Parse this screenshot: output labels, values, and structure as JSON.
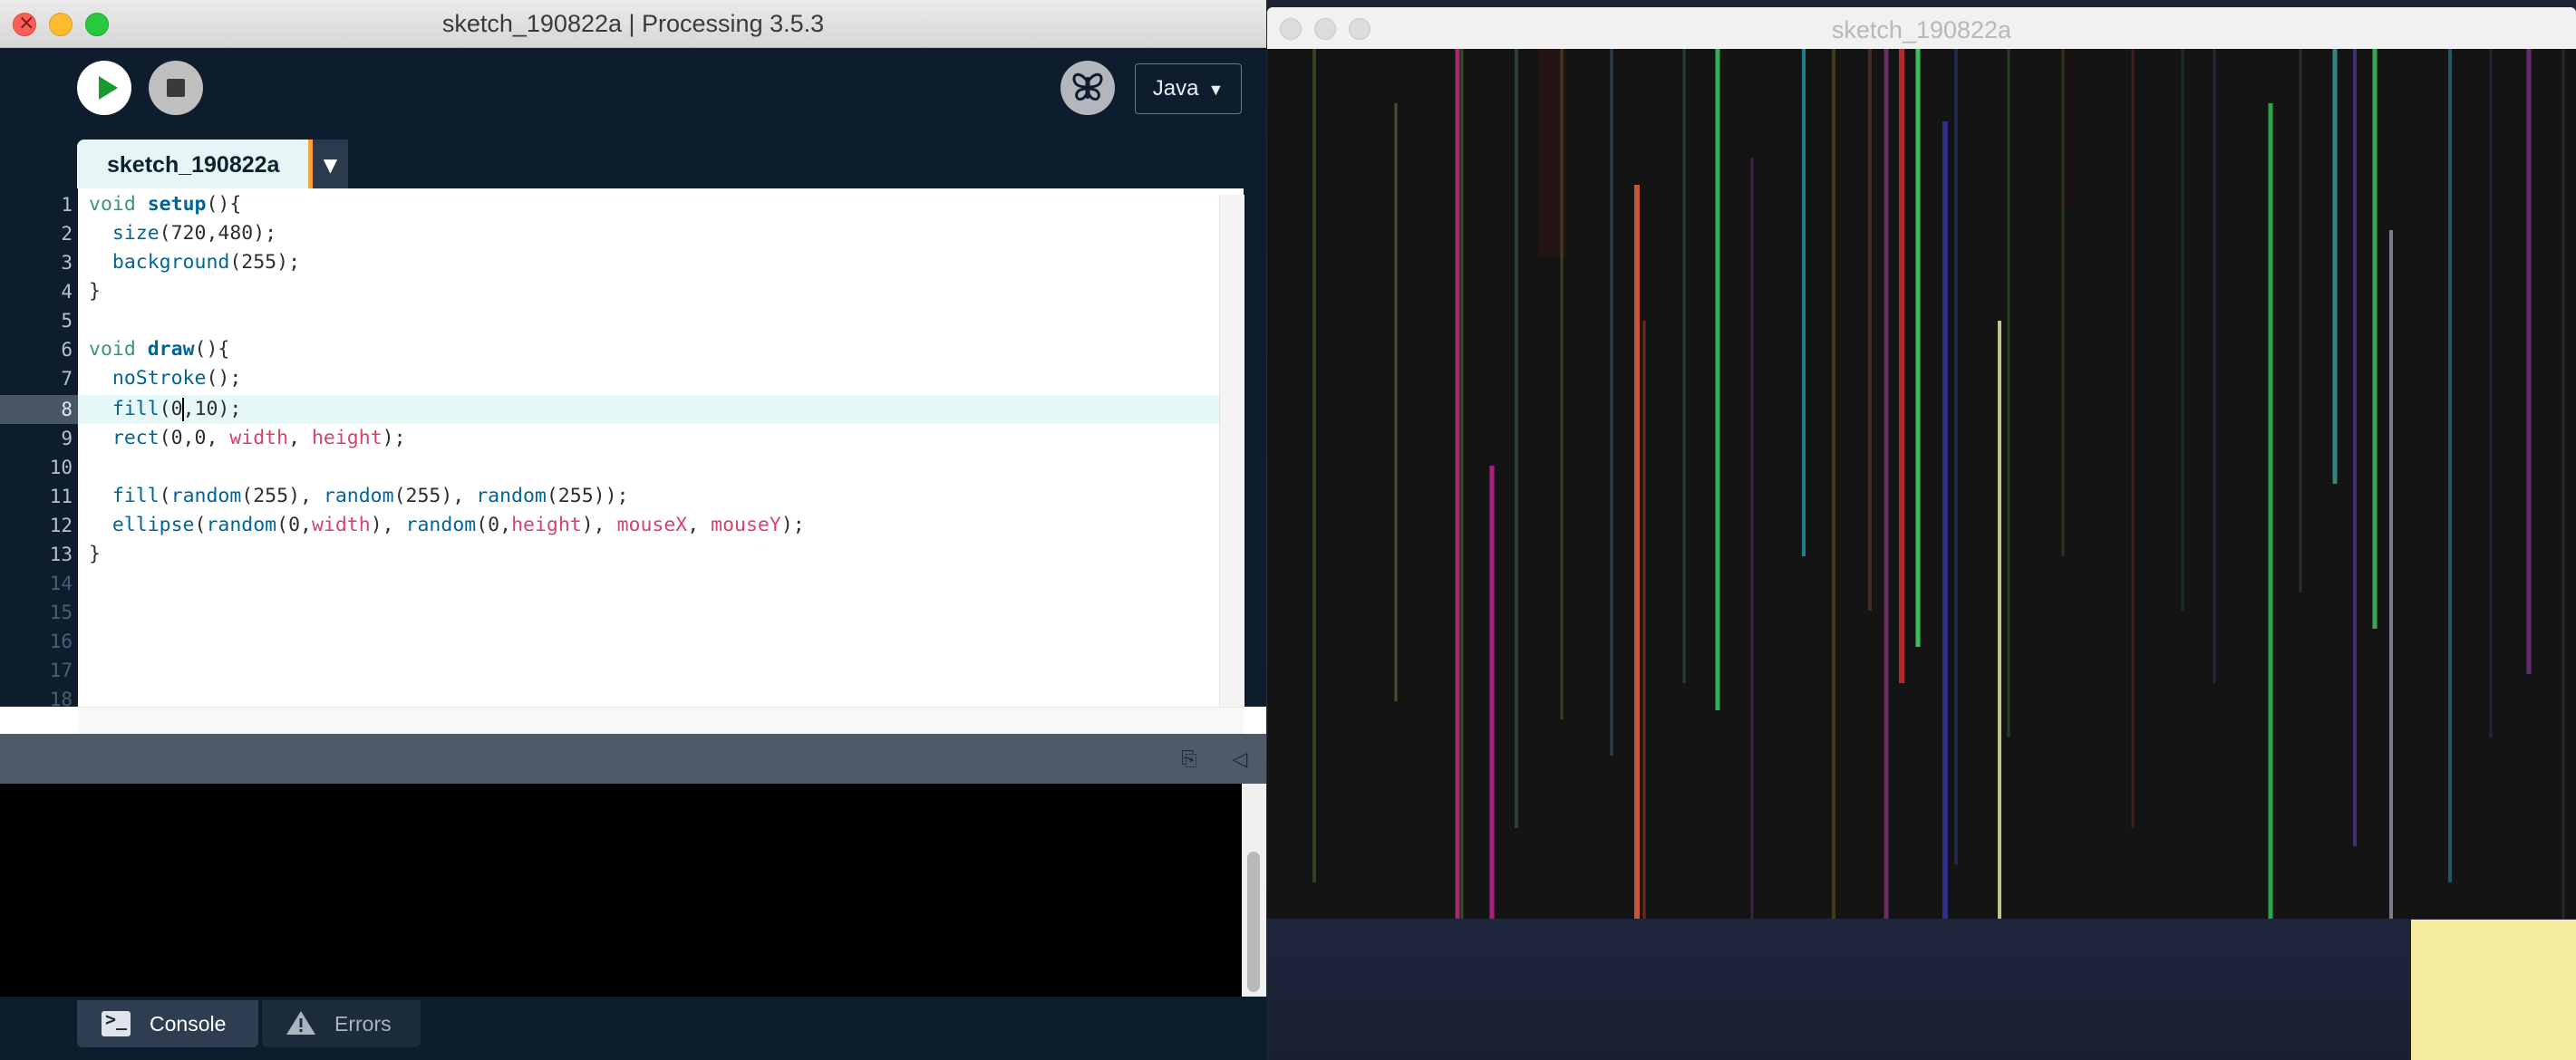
{
  "ide": {
    "title": "sketch_190822a | Processing 3.5.3",
    "mode_label": "Java",
    "tab_label": "sketch_190822a",
    "line_numbers": [
      "1",
      "2",
      "3",
      "4",
      "5",
      "6",
      "7",
      "8",
      "9",
      "10",
      "11",
      "12",
      "13",
      "14",
      "15",
      "16",
      "17",
      "18"
    ],
    "code": {
      "l1_kw": "void",
      "l1_fn": "setup",
      "l1_rest": "(){",
      "l2_fn": "size",
      "l2_rest": "(720,480);",
      "l3_fn": "background",
      "l3_rest": "(255);",
      "l4": "}",
      "l6_kw": "void",
      "l6_fn": "draw",
      "l6_rest": "(){",
      "l7_fn": "noStroke",
      "l7_rest": "();",
      "l8_fn": "fill",
      "l8_a": "(0",
      "l8_b": ",10);",
      "l9_fn": "rect",
      "l9_a": "(0,0, ",
      "l9_v1": "width",
      "l9_b": ", ",
      "l9_v2": "height",
      "l9_c": ");",
      "l11_fn1": "fill",
      "l11_a": "(",
      "l11_fn2": "random",
      "l11_b": "(255), ",
      "l11_fn3": "random",
      "l11_c": "(255), ",
      "l11_fn4": "random",
      "l11_d": "(255));",
      "l12_fn1": "ellipse",
      "l12_a": "(",
      "l12_fn2": "random",
      "l12_b": "(0,",
      "l12_v1": "width",
      "l12_c": "), ",
      "l12_fn3": "random",
      "l12_d": "(0,",
      "l12_v2": "height",
      "l12_e": "), ",
      "l12_v3": "mouseX",
      "l12_f": ", ",
      "l12_v4": "mouseY",
      "l12_g": ");",
      "l13": "}"
    },
    "console_tab_label": "Console",
    "errors_tab_label": "Errors"
  },
  "sketch_window": {
    "title": "sketch_190822a"
  },
  "icons": {
    "run": "play-icon",
    "stop": "stop-icon",
    "debug": "butterfly-debugger-icon",
    "copy": "copy-icon",
    "collapse": "collapse-triangle-icon",
    "console": "terminal-icon",
    "errors": "warning-icon"
  },
  "colors": {
    "ide_background": "#0d1d2e",
    "canvas_background": "#141414",
    "keyword": "#33997e",
    "function": "#006699",
    "variable": "#d9426b",
    "tab_accent": "#f8a23b"
  }
}
